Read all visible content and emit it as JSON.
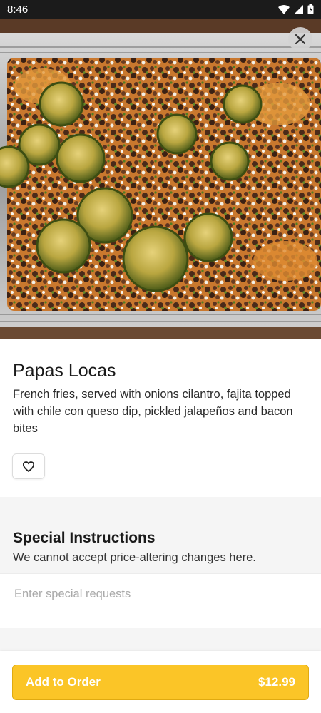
{
  "status_bar": {
    "time": "8:46"
  },
  "item": {
    "name": "Papas Locas",
    "description": "French fries, served with onions cilantro, fajita topped with chile con queso dip, pickled jalapeños and bacon bites"
  },
  "special_instructions": {
    "title": "Special Instructions",
    "subtitle": "We cannot accept price-altering changes here.",
    "placeholder": "Enter special requests",
    "value": ""
  },
  "order_button": {
    "label": "Add to Order",
    "price": "$12.99"
  },
  "colors": {
    "accent": "#fbc527",
    "status_bar": "#1b1b1b"
  },
  "icons": [
    "wifi-icon",
    "cell-signal-icon",
    "battery-icon",
    "close-icon",
    "heart-icon"
  ]
}
